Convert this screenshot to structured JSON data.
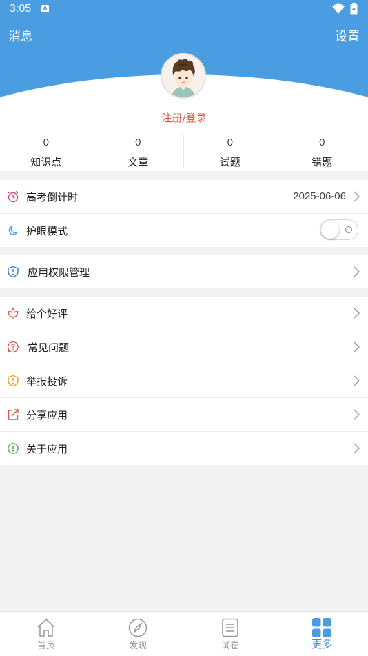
{
  "status_bar": {
    "time": "3:05",
    "notif_icon": "A"
  },
  "header": {
    "left": "消息",
    "right": "设置"
  },
  "login": "注册/登录",
  "stats": [
    {
      "value": "0",
      "label": "知识点"
    },
    {
      "value": "0",
      "label": "文章"
    },
    {
      "value": "0",
      "label": "试题"
    },
    {
      "value": "0",
      "label": "错题"
    }
  ],
  "group1": {
    "countdown": {
      "label": "高考倒计时",
      "value": "2025-06-06",
      "icon": "alarm-clock-icon",
      "color": "#e0468a"
    },
    "eye": {
      "label": "护眼模式",
      "icon": "moon-icon",
      "color": "#3ea0e8",
      "enabled": false
    }
  },
  "group2": {
    "permissions": {
      "label": "应用权限管理",
      "icon": "shield-icon",
      "color": "#2f7fd8"
    }
  },
  "group3": [
    {
      "name": "rate",
      "label": "给个好评",
      "icon": "flower-icon",
      "color": "#e0564a"
    },
    {
      "name": "faq",
      "label": "常见问题",
      "icon": "question-icon",
      "color": "#e0564a"
    },
    {
      "name": "report",
      "label": "举报投诉",
      "icon": "warning-shield-icon",
      "color": "#e8a020"
    },
    {
      "name": "share",
      "label": "分享应用",
      "icon": "share-icon",
      "color": "#e0564a"
    },
    {
      "name": "about",
      "label": "关于应用",
      "icon": "info-icon",
      "color": "#3aaa35"
    }
  ],
  "tabs": [
    {
      "name": "home",
      "label": "首页",
      "icon": "home-icon",
      "active": false
    },
    {
      "name": "discover",
      "label": "发现",
      "icon": "compass-icon",
      "active": false
    },
    {
      "name": "papers",
      "label": "试卷",
      "icon": "document-icon",
      "active": false
    },
    {
      "name": "more",
      "label": "更多",
      "icon": "grid-icon",
      "active": true
    }
  ],
  "colors": {
    "header": "#4a9de0",
    "accent": "#e0564a",
    "tab_active": "#3e8fd6"
  }
}
